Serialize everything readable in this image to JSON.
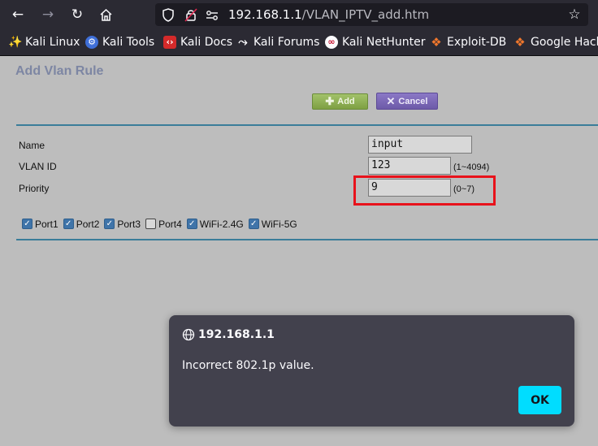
{
  "browser": {
    "url_host": "192.168.1.1",
    "url_path": "/VLAN_IPTV_add.htm",
    "bookmarks": [
      {
        "label": "Kali Linux",
        "icon": "kali-dragon-icon"
      },
      {
        "label": "Kali Tools",
        "icon": "kali-tools-icon"
      },
      {
        "label": "Kali Docs",
        "icon": "kali-docs-icon"
      },
      {
        "label": "Kali Forums",
        "icon": "kali-forums-icon"
      },
      {
        "label": "Kali NetHunter",
        "icon": "nethunter-icon"
      },
      {
        "label": "Exploit-DB",
        "icon": "exploit-db-icon"
      },
      {
        "label": "Google Hack",
        "icon": "google-hacking-icon"
      }
    ]
  },
  "page": {
    "title": "Add Vlan Rule",
    "add_label": "Add",
    "cancel_label": "Cancel",
    "fields": {
      "name_label": "Name",
      "name_value": "input",
      "vlan_label": "VLAN ID",
      "vlan_value": "123",
      "vlan_hint": "(1~4094)",
      "priority_label": "Priority",
      "priority_value": "9",
      "priority_hint": "(0~7)"
    },
    "ports": [
      {
        "label": "Port1",
        "checked": true
      },
      {
        "label": "Port2",
        "checked": true
      },
      {
        "label": "Port3",
        "checked": true
      },
      {
        "label": "Port4",
        "checked": false
      },
      {
        "label": "WiFi-2.4G",
        "checked": true
      },
      {
        "label": "WiFi-5G",
        "checked": true
      }
    ]
  },
  "dialog": {
    "title": "192.168.1.1",
    "message": "Incorrect 802.1p value.",
    "ok_label": "OK"
  },
  "colors": {
    "highlight": "#e8121b",
    "ok_button": "#00ddff",
    "rule": "#3a7d99"
  }
}
